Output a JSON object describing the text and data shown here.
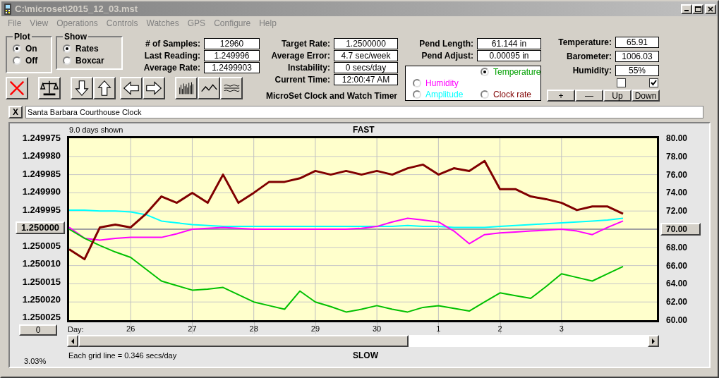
{
  "window": {
    "title": "C:\\microset\\2015_12_03.mst"
  },
  "menu": [
    "File",
    "View",
    "Operations",
    "Controls",
    "Watches",
    "GPS",
    "Configure",
    "Help"
  ],
  "plot_group": {
    "title": "Plot",
    "options": [
      {
        "label": "On",
        "selected": true
      },
      {
        "label": "Off",
        "selected": false
      }
    ]
  },
  "show_group": {
    "title": "Show",
    "options": [
      {
        "label": "Rates",
        "selected": true
      },
      {
        "label": "Boxcar",
        "selected": false
      }
    ]
  },
  "readouts_samples": [
    {
      "label": "# of Samples:",
      "value": "12960"
    },
    {
      "label": "Last Reading:",
      "value": "1.249996"
    },
    {
      "label": "Average Rate:",
      "value": "1.2499903"
    }
  ],
  "readouts_rate": [
    {
      "label": "Target Rate:",
      "value": "1.2500000"
    },
    {
      "label": "Average Error:",
      "value": "4.7 sec/week"
    },
    {
      "label": "Instability:",
      "value": "0 secs/day"
    },
    {
      "label": "Current Time:",
      "value": "12:00:47 AM"
    }
  ],
  "app_caption": "MicroSet Clock and Watch Timer",
  "readouts_pend": [
    {
      "label": "Pend Length:",
      "value": "61.144 in"
    },
    {
      "label": "Pend Adjust:",
      "value": "0.00095 in"
    }
  ],
  "plot_select": [
    {
      "label": "Temperature",
      "color": "#00a000",
      "selected": true
    },
    {
      "label": "Humidity",
      "color": "#ff00ff",
      "selected": false
    },
    {
      "label": "Amplitude",
      "color": "#00ffff",
      "selected": false
    },
    {
      "label": "Clock rate",
      "color": "#800000",
      "selected": false
    }
  ],
  "readouts_env": [
    {
      "label": "Temperature:",
      "value": "65.91"
    },
    {
      "label": "Barometer:",
      "value": "1006.03"
    },
    {
      "label": "Humidity:",
      "value": "55%"
    }
  ],
  "checkboxes": [
    {
      "checked": false
    },
    {
      "checked": true
    }
  ],
  "adjust_buttons": [
    "+",
    "—",
    "Up",
    "Down"
  ],
  "clear_button": "X",
  "clock_name": "Santa Barbara Courthouse Clock",
  "chart": {
    "days_shown": "9.0 days shown",
    "top_label": "FAST",
    "bottom_label": "SLOW",
    "left_axis": [
      "1.249975",
      "1.249980",
      "1.249985",
      "1.249990",
      "1.249995",
      "1.250000",
      "1.250005",
      "1.250010",
      "1.250015",
      "1.250020",
      "1.250025"
    ],
    "zero_button": "0",
    "day_label": "Day:",
    "percent": "3.03%",
    "grid_note": "Each grid line = 0.346 secs/day",
    "next_month_days": [
      "1",
      "2",
      "3"
    ],
    "chart_data": {
      "type": "line",
      "xlim": [
        25,
        34.55
      ],
      "ylim": [
        60,
        80
      ],
      "grid": true,
      "ref_lines": [
        {
          "axis": "y",
          "value": 70
        }
      ],
      "xticks": [
        26,
        27,
        28,
        29,
        30
      ],
      "yticks": [
        {
          "value": 80,
          "label": "80.00"
        },
        {
          "value": 78,
          "label": "78.00"
        },
        {
          "value": 76,
          "label": "76.00"
        },
        {
          "value": 74,
          "label": "74.00"
        },
        {
          "value": 72,
          "label": "72.00"
        },
        {
          "value": 70,
          "label": "70.00"
        },
        {
          "value": 68,
          "label": "68.00"
        },
        {
          "value": 66,
          "label": "66.00"
        },
        {
          "value": 64,
          "label": "64.00"
        },
        {
          "value": 62,
          "label": "62.00"
        },
        {
          "value": 60,
          "label": "60.00"
        }
      ],
      "x": [
        25,
        25.25,
        25.5,
        25.75,
        26,
        26.25,
        26.5,
        26.75,
        27,
        27.25,
        27.5,
        27.75,
        28,
        28.25,
        28.5,
        28.75,
        29,
        29.25,
        29.5,
        29.75,
        30,
        30.25,
        30.5,
        30.75,
        31,
        31.25,
        31.5,
        31.75,
        32,
        32.25,
        32.5,
        32.75,
        33,
        33.25,
        33.5,
        33.75,
        34
      ],
      "series": [
        {
          "color": "#00ffff",
          "values": [
            72.1,
            72.1,
            72.0,
            72.0,
            71.9,
            71.6,
            70.9,
            70.7,
            70.5,
            70.4,
            70.3,
            70.3,
            70.3,
            70.3,
            70.3,
            70.3,
            70.3,
            70.3,
            70.3,
            70.3,
            70.3,
            70.3,
            70.4,
            70.3,
            70.3,
            70.2,
            70.2,
            70.2,
            70.3,
            70.4,
            70.5,
            70.6,
            70.7,
            70.8,
            70.9,
            71.0,
            71.2
          ]
        },
        {
          "color": "#ff00ff",
          "values": [
            70.2,
            69.0,
            68.8,
            69.0,
            69.1,
            69.1,
            69.1,
            69.5,
            70.0,
            70.1,
            70.2,
            70.1,
            70.0,
            70.0,
            70.0,
            70.0,
            70.0,
            70.0,
            70.0,
            70.1,
            70.3,
            70.8,
            71.2,
            71.0,
            70.8,
            69.8,
            68.4,
            69.4,
            69.6,
            69.7,
            69.8,
            69.9,
            70.0,
            69.8,
            69.4,
            70.2,
            70.9
          ]
        },
        {
          "color": "#00c000",
          "values": [
            70.0,
            69.0,
            68.2,
            67.5,
            66.9,
            65.6,
            64.3,
            63.8,
            63.3,
            63.4,
            63.6,
            62.8,
            62.0,
            61.6,
            61.2,
            63.2,
            62.0,
            61.5,
            60.9,
            61.2,
            61.6,
            61.2,
            60.9,
            61.4,
            61.6,
            61.3,
            61.0,
            62.0,
            63.0,
            62.7,
            62.4,
            63.7,
            65.1,
            64.7,
            64.3,
            65.1,
            65.9
          ]
        },
        {
          "color": "#800000",
          "values": [
            67.8,
            66.7,
            70.2,
            70.5,
            70.2,
            71.7,
            73.6,
            72.9,
            74.0,
            72.9,
            76.0,
            72.9,
            74.0,
            75.2,
            75.2,
            75.6,
            76.4,
            76.0,
            76.4,
            76.0,
            76.4,
            76.0,
            76.7,
            77.1,
            76.0,
            76.7,
            76.4,
            77.5,
            74.4,
            74.4,
            73.6,
            73.3,
            72.9,
            72.1,
            72.5,
            72.5,
            71.7
          ]
        }
      ]
    }
  }
}
